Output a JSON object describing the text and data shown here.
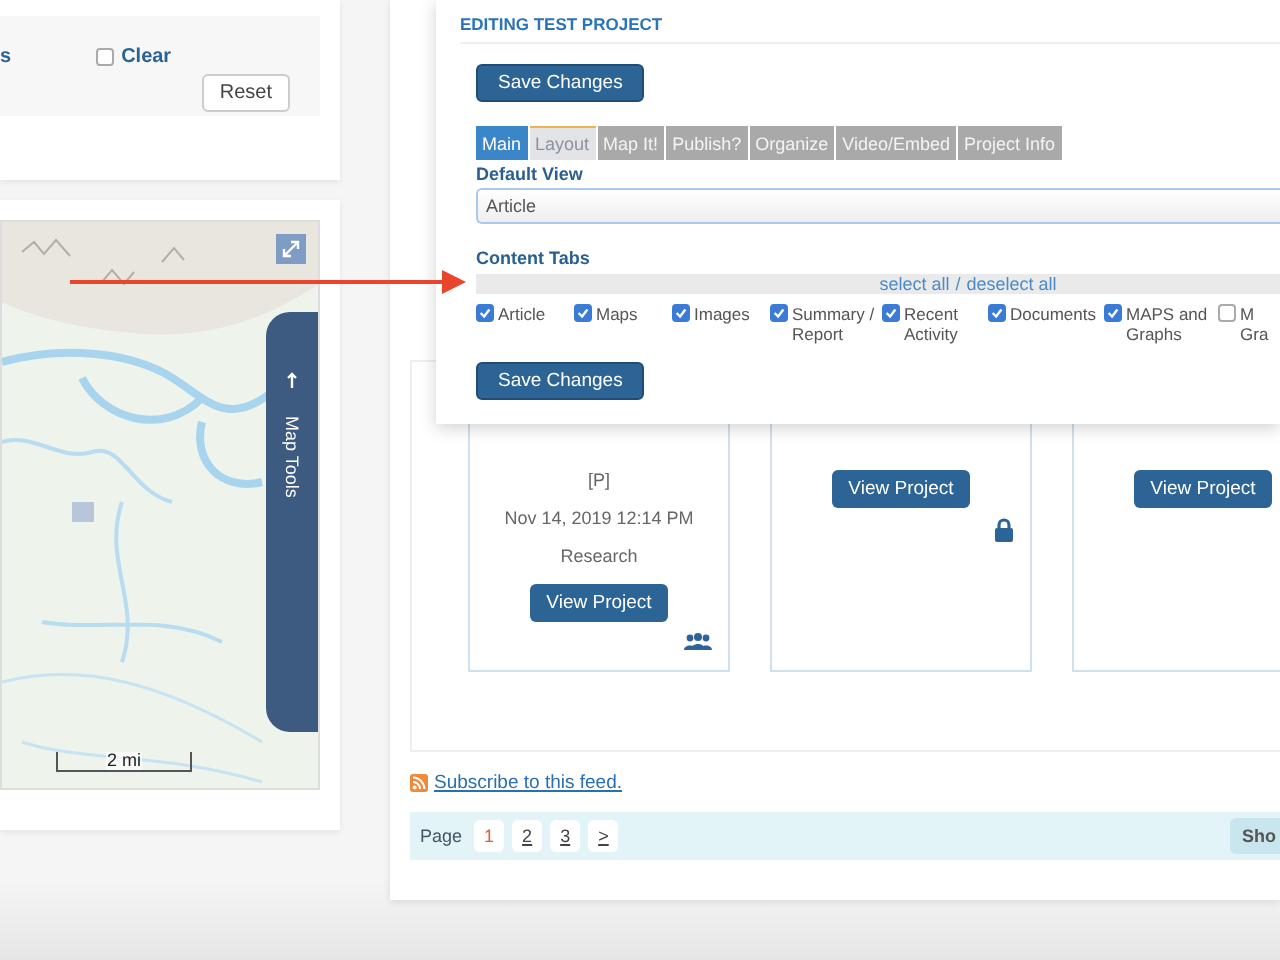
{
  "filter_panel": {
    "partial_label": "s",
    "clear": {
      "label": "Clear",
      "checked": false
    },
    "reset_button": "Reset"
  },
  "map": {
    "scale_label": "2 mi",
    "tools_tab": "Map Tools"
  },
  "editor": {
    "title": "EDITING TEST PROJECT",
    "save_button": "Save Changes",
    "tabs": [
      {
        "label": "Main",
        "selected": true,
        "highlighted": false
      },
      {
        "label": "Layout",
        "selected": false,
        "highlighted": true
      },
      {
        "label": "Map It!",
        "selected": false,
        "highlighted": false
      },
      {
        "label": "Publish?",
        "selected": false,
        "highlighted": false
      },
      {
        "label": "Organize",
        "selected": false,
        "highlighted": false
      },
      {
        "label": "Video/Embed",
        "selected": false,
        "highlighted": false
      },
      {
        "label": "Project Info",
        "selected": false,
        "highlighted": false
      }
    ],
    "default_view": {
      "label": "Default View",
      "value": "Article"
    },
    "content_tabs": {
      "label": "Content Tabs",
      "select_all": "select all",
      "separator": "/",
      "deselect_all": "deselect all",
      "items": [
        {
          "label": "Article",
          "checked": true
        },
        {
          "label": "Maps",
          "checked": true
        },
        {
          "label": "Images",
          "checked": true
        },
        {
          "label": "Summary / Report",
          "checked": true
        },
        {
          "label": "Recent Activity",
          "checked": true
        },
        {
          "label": "Documents",
          "checked": true
        },
        {
          "label": "MAPS and Graphs",
          "checked": true
        },
        {
          "label": "M Gra",
          "checked": false
        }
      ]
    },
    "save_button_bottom": "Save Changes"
  },
  "projects": [
    {
      "code": "[P]",
      "date": "Nov 14, 2019 12:14 PM",
      "category": "Research",
      "button": "View Project",
      "kind": "group"
    },
    {
      "button": "View Project",
      "kind": "locked"
    },
    {
      "button": "View Project"
    }
  ],
  "feed_link": "Subscribe to this feed.",
  "pagination": {
    "label": "Page",
    "pages": [
      {
        "label": "1",
        "selected": true
      },
      {
        "label": "2",
        "selected": false
      },
      {
        "label": "3",
        "selected": false
      }
    ],
    "next": ">",
    "show_label": "Sho"
  }
}
